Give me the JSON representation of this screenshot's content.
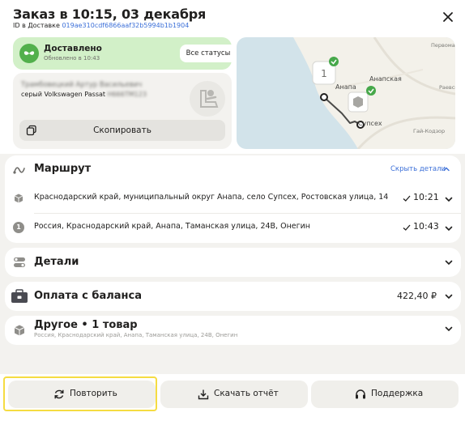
{
  "header": {
    "title": "Заказ в 10:15, 03 декабря",
    "id_label": "ID в Доставке",
    "id_value": "019ae310cdf6866aaf32b5994b1b1904",
    "colors": {
      "link": "#3b6fd8"
    }
  },
  "status": {
    "title": "Доставлено",
    "time": "Обновлено в 10:43",
    "all_statuses_label": "Все статусы",
    "color": "#d2f0c8"
  },
  "driver": {
    "name": "Трамбовецкий Артур Васильевич",
    "car": "серый Volkswagen Passat",
    "plate": "Н666ТМ123",
    "copy_label": "Скопировать"
  },
  "map": {
    "labels": {
      "anapa": "Анапа",
      "anapskaya": "Анапская",
      "suphes": "Супсех",
      "gai": "Гай-Кодзор",
      "raevskaya": "Раевская",
      "pervomaysky": "Первомайский"
    },
    "cluster_count": "1"
  },
  "route": {
    "title": "Маршрут",
    "hide_label": "Скрыть детали",
    "stops": [
      {
        "text": "Краснодарский край, муниципальный округ Анапа, село Супсех, Ростовская улица, 14",
        "time": "10:21"
      },
      {
        "marker": "1",
        "text": "Россия, Краснодарский край, Анапа, Таманская улица, 24В, Онегин",
        "time": "10:43"
      }
    ]
  },
  "details": {
    "title": "Детали"
  },
  "payment": {
    "title": "Оплата с баланса",
    "amount": "422,40 ₽"
  },
  "other": {
    "title": "Другое • 1 товар",
    "subtitle": "Россия, Краснодарский край, Анапа, Таманская улица, 24В, Онегин"
  },
  "footer": {
    "repeat_label": "Повторить",
    "download_label": "Скачать отчёт",
    "support_label": "Поддержка"
  }
}
